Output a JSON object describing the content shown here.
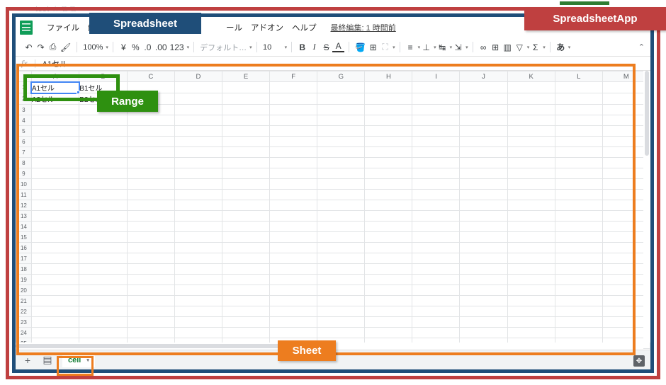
{
  "window": {
    "browser_tab_title": "test ☆ ⧉ ⧉",
    "app_title_callout": "SpreadsheetApp",
    "spreadsheet_callout": "Spreadsheet",
    "range_callout": "Range",
    "sheet_callout": "Sheet"
  },
  "colors": {
    "app_frame": "#bf4040",
    "spreadsheet_frame": "#1f4e79",
    "sheet_frame": "#ed7d1f",
    "range_frame": "#2e9010",
    "sheets_green": "#0f9d58",
    "selection_blue": "#4285f4"
  },
  "menubar": {
    "doc_icon": "sheets-doc-icon",
    "items": [
      {
        "label": "ファイル"
      },
      {
        "label": "編集"
      },
      {
        "label": "ール"
      },
      {
        "label": "アドオン"
      },
      {
        "label": "ヘルプ"
      }
    ],
    "last_edit": "最終編集: 1 時間前"
  },
  "toolbar": {
    "groups": [
      {
        "items": [
          {
            "name": "undo-icon",
            "glyph": "↶"
          },
          {
            "name": "redo-icon",
            "glyph": "↷"
          },
          {
            "name": "print-icon",
            "glyph": "⎙"
          },
          {
            "name": "paint-format-icon",
            "glyph": "🖌"
          }
        ]
      },
      {
        "items": [
          {
            "name": "zoom-select",
            "glyph": "100%",
            "caret": true
          }
        ]
      },
      {
        "items": [
          {
            "name": "currency-icon",
            "glyph": "¥"
          },
          {
            "name": "percent-icon",
            "glyph": "%"
          },
          {
            "name": "decrease-decimal-icon",
            "glyph": ".0"
          },
          {
            "name": "increase-decimal-icon",
            "glyph": ".00"
          },
          {
            "name": "number-format-icon",
            "glyph": "123",
            "caret": true
          }
        ]
      },
      {
        "items": [
          {
            "name": "font-select",
            "glyph": "デフォルト…",
            "caret": true
          }
        ]
      },
      {
        "items": [
          {
            "name": "font-size-select",
            "glyph": "10",
            "caret": true
          }
        ]
      },
      {
        "items": [
          {
            "name": "bold-icon",
            "glyph": "B"
          },
          {
            "name": "italic-icon",
            "glyph": "I"
          },
          {
            "name": "strikethrough-icon",
            "glyph": "S"
          },
          {
            "name": "text-color-icon",
            "glyph": "A"
          }
        ]
      },
      {
        "items": [
          {
            "name": "fill-color-icon",
            "glyph": "🪣"
          },
          {
            "name": "borders-icon",
            "glyph": "⊞"
          },
          {
            "name": "merge-cells-icon",
            "glyph": "⛶",
            "caret": true,
            "dim": true
          }
        ]
      },
      {
        "items": [
          {
            "name": "horizontal-align-icon",
            "glyph": "≡",
            "caret": true
          },
          {
            "name": "vertical-align-icon",
            "glyph": "⊥",
            "caret": true
          },
          {
            "name": "text-wrap-icon",
            "glyph": "↹",
            "caret": true
          },
          {
            "name": "text-rotation-icon",
            "glyph": "⇲",
            "caret": true
          }
        ]
      },
      {
        "items": [
          {
            "name": "insert-link-icon",
            "glyph": "∞"
          },
          {
            "name": "insert-comment-icon",
            "glyph": "⊞"
          },
          {
            "name": "insert-chart-icon",
            "glyph": "▥"
          },
          {
            "name": "filter-icon",
            "glyph": "▽",
            "caret": true
          },
          {
            "name": "functions-icon",
            "glyph": "Σ",
            "caret": true
          }
        ]
      },
      {
        "items": [
          {
            "name": "input-tools-icon",
            "glyph": "あ",
            "caret": true
          }
        ]
      }
    ],
    "collapse_icon": "⌃"
  },
  "formula_bar": {
    "fx_icon": "fx",
    "value": "A1セル"
  },
  "grid": {
    "columns": [
      "A",
      "B",
      "C",
      "D",
      "E",
      "F",
      "G",
      "H",
      "I",
      "J",
      "K",
      "L",
      "M"
    ],
    "row_count": 28,
    "cells": {
      "A1": "A1セル",
      "B1": "B1セル",
      "A2": "A2セル",
      "B2": "B2セル"
    },
    "selected_cell": "A1",
    "selected_range": "A1:B2"
  },
  "sheetbar": {
    "add_sheet_icon": "+",
    "all_sheets_icon": "▤",
    "tabs": [
      {
        "label": "cell",
        "caret": "▾",
        "active": true
      }
    ],
    "explore_icon": "explore-icon"
  }
}
